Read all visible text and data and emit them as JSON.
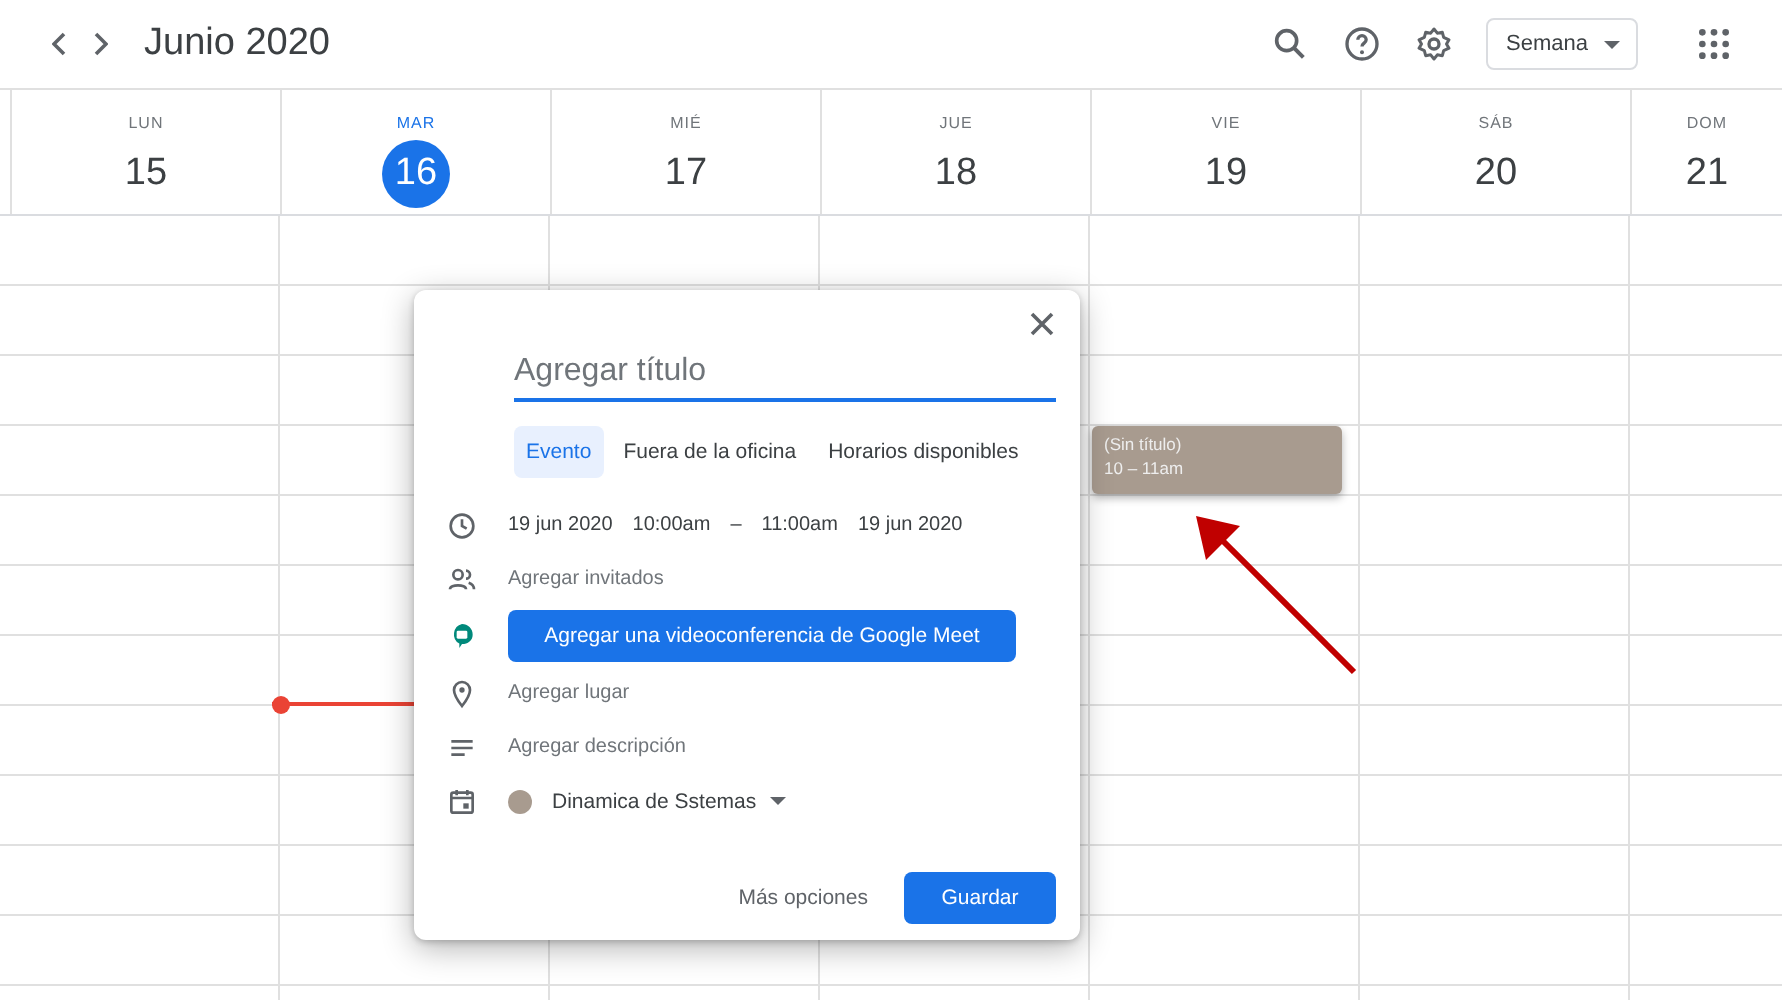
{
  "header": {
    "title": "Junio 2020",
    "view": "Semana"
  },
  "days": [
    {
      "weekday": "LUN",
      "date": "15",
      "selected": false
    },
    {
      "weekday": "MAR",
      "date": "16",
      "selected": true
    },
    {
      "weekday": "MIÉ",
      "date": "17",
      "selected": false
    },
    {
      "weekday": "JUE",
      "date": "18",
      "selected": false
    },
    {
      "weekday": "VIE",
      "date": "19",
      "selected": false
    },
    {
      "weekday": "SÁB",
      "date": "20",
      "selected": false
    },
    {
      "weekday": "DOM",
      "date": "21",
      "selected": false
    }
  ],
  "event": {
    "title": "(Sin título)",
    "time": "10 – 11am",
    "color": "#a89b8f"
  },
  "dialog": {
    "title_placeholder": "Agregar título",
    "tabs": [
      {
        "label": "Evento",
        "selected": true
      },
      {
        "label": "Fuera de la oficina",
        "selected": false
      },
      {
        "label": "Horarios disponibles",
        "selected": false
      }
    ],
    "rows": [
      {
        "kind": "datetime",
        "parts": [
          "19 jun 2020",
          "10:00am",
          "–",
          "11:00am",
          "19 jun 2020"
        ]
      },
      {
        "kind": "guests",
        "text": "Agregar invitados"
      },
      {
        "kind": "meet",
        "text": "Agregar una videoconferencia de Google Meet"
      },
      {
        "kind": "location",
        "text": "Agregar lugar"
      },
      {
        "kind": "description",
        "text": "Agregar descripción"
      },
      {
        "kind": "calendar",
        "text": "Dinamica de Sstemas",
        "color": "#a89b8f"
      }
    ],
    "more": "Más opciones",
    "save": "Guardar"
  }
}
